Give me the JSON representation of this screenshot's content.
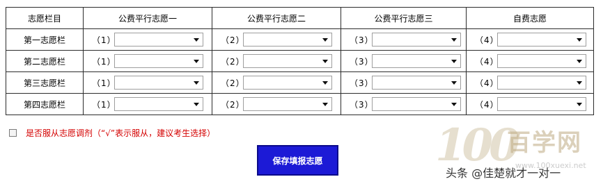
{
  "table": {
    "headers": [
      "志愿栏目",
      "公费平行志愿一",
      "公费平行志愿二",
      "公费平行志愿三",
      "自费志愿"
    ],
    "rows": [
      {
        "label": "第一志愿栏",
        "choices": [
          "（1）",
          "（2）",
          "（3）",
          "（4）"
        ]
      },
      {
        "label": "第二志愿栏",
        "choices": [
          "（1）",
          "（2）",
          "（3）",
          "（4）"
        ]
      },
      {
        "label": "第三志愿栏",
        "choices": [
          "（1）",
          "（2）",
          "（3）",
          "（4）"
        ]
      },
      {
        "label": "第四志愿栏",
        "choices": [
          "（1）",
          "（2）",
          "（3）",
          "（4）"
        ]
      }
    ]
  },
  "adjust": {
    "label": "是否服从志愿调剂（“√”表示服从，建议考生选择）",
    "checked": false
  },
  "save_button": {
    "label": "保存填报志愿"
  },
  "watermark": {
    "logo": "100",
    "name": "百学网",
    "url": "www.100xuexi.net",
    "author": "头条 @佳楚就才一对一"
  },
  "colors": {
    "accent": "#1c1ad6",
    "warning_text": "#d40000",
    "border": "#2b2b2b"
  }
}
